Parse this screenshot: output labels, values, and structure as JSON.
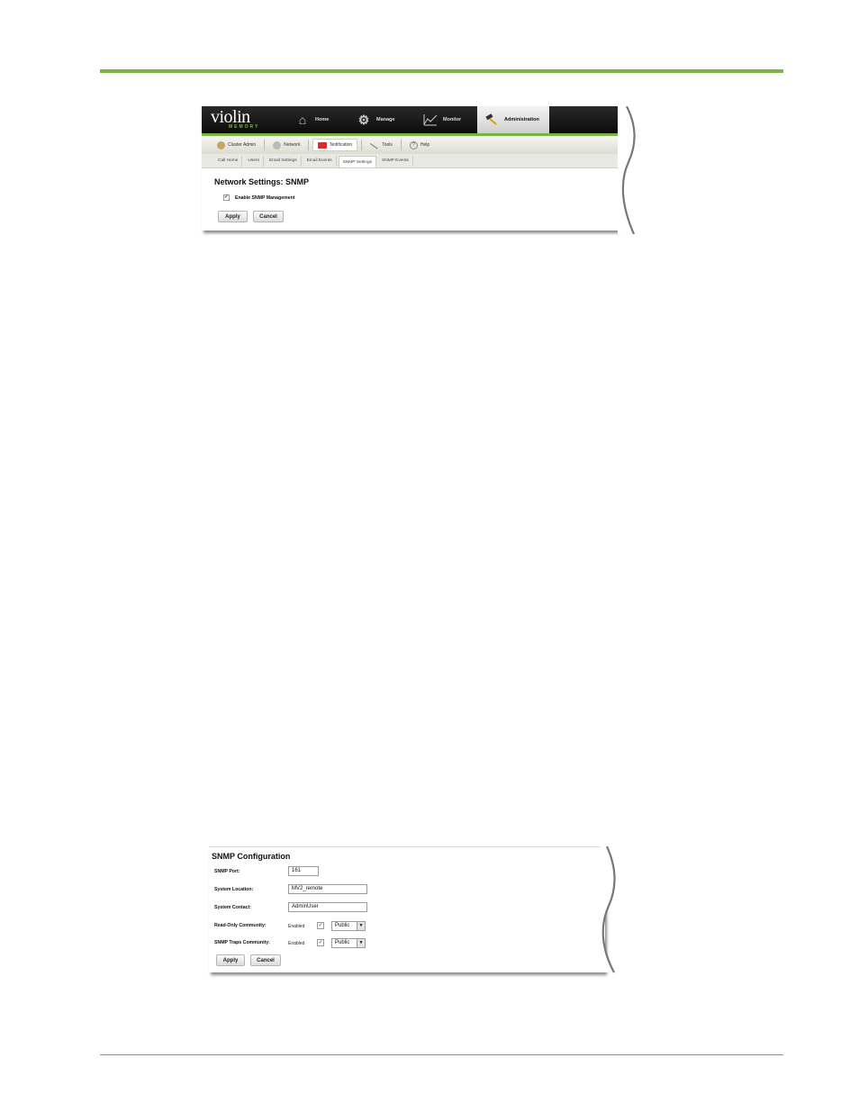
{
  "screenshot1": {
    "logo": {
      "main": "violin",
      "sub": "MEMORY"
    },
    "nav": [
      {
        "label": "Home",
        "icon": "home-icon"
      },
      {
        "label": "Manage",
        "icon": "gear-icon"
      },
      {
        "label": "Monitor",
        "icon": "chart-icon"
      },
      {
        "label": "Administration",
        "icon": "hammer-icon",
        "active": true
      }
    ],
    "subnav": [
      {
        "label": "Cluster Admin",
        "icon": "user-icon"
      },
      {
        "label": "Network",
        "icon": "globe-icon"
      },
      {
        "label": "Notification",
        "icon": "mail-icon",
        "active": true
      },
      {
        "label": "Tools",
        "icon": "wrench-icon"
      },
      {
        "label": "Help",
        "icon": "help-icon"
      }
    ],
    "tabs": [
      {
        "label": "Call Home"
      },
      {
        "label": "Users"
      },
      {
        "label": "Email Settings"
      },
      {
        "label": "Email Events"
      },
      {
        "label": "SNMP Settings",
        "active": true
      },
      {
        "label": "SNMP Events"
      }
    ],
    "title": "Network Settings: SNMP",
    "enable_label": "Enable SNMP Management",
    "enable_checked": true,
    "apply_label": "Apply",
    "cancel_label": "Cancel"
  },
  "screenshot2": {
    "title": "SNMP Configuration",
    "port_label": "SNMP Port:",
    "port_value": "161",
    "location_label": "System Location:",
    "location_value": "MV2_remote",
    "contact_label": "System Contact:",
    "contact_value": "AdminUser",
    "readonly_label": "Read-Only Community:",
    "readonly_enabled_label": "Enabled",
    "readonly_checked": true,
    "readonly_value": "Public",
    "traps_label": "SNMP Traps Community:",
    "traps_enabled_label": "Enabled",
    "traps_checked": true,
    "traps_value": "Public",
    "apply_label": "Apply",
    "cancel_label": "Cancel"
  },
  "colors": {
    "accent_green": "#7cb342",
    "header_dark": "#111111"
  }
}
